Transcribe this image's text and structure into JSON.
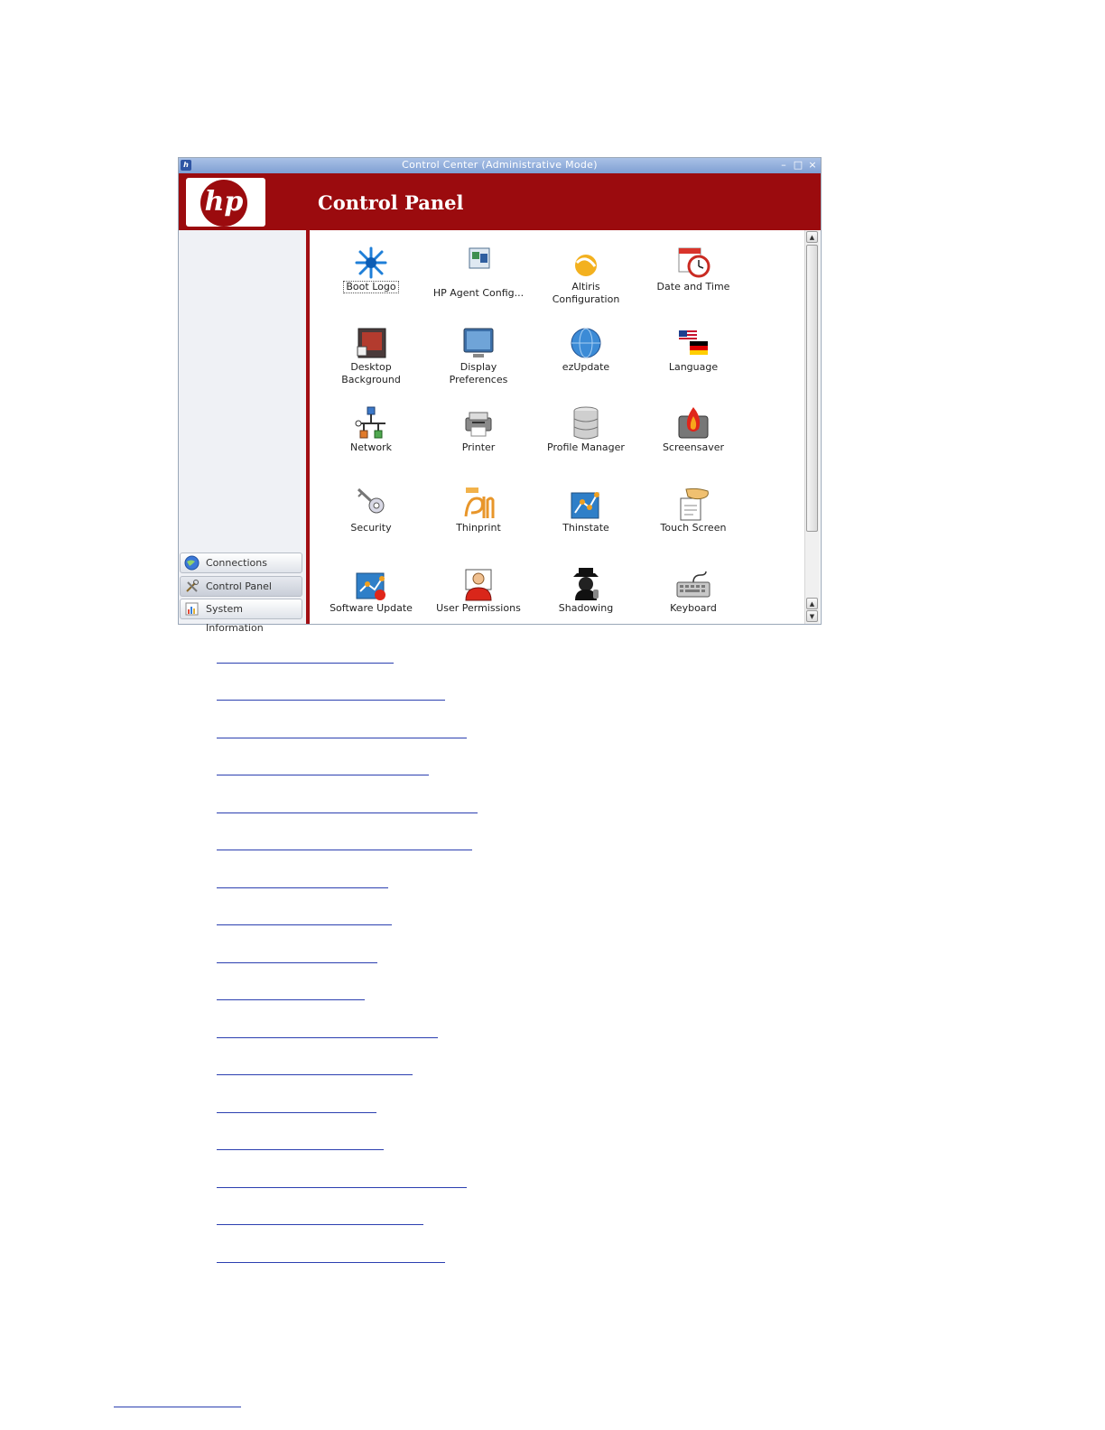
{
  "window": {
    "title": "Control Center (Administrative Mode)",
    "minimize_glyph": "–",
    "maximize_glyph": "□",
    "close_glyph": "×",
    "header_title": "Control Panel",
    "logo_text": "hp"
  },
  "sidebar": {
    "items": [
      {
        "label": "Connections",
        "icon": "globe-icon"
      },
      {
        "label": "Control Panel",
        "icon": "tools-icon"
      },
      {
        "label": "System Information",
        "icon": "chart-icon"
      }
    ]
  },
  "control_panel": {
    "items": [
      {
        "label": "Boot Logo",
        "icon": "splash-icon"
      },
      {
        "label": "HP Agent Config...",
        "icon": "agent-config-icon"
      },
      {
        "label": "Altiris\nConfiguration",
        "icon": "altiris-icon"
      },
      {
        "label": "Date and Time",
        "icon": "calendar-clock-icon"
      },
      {
        "label": "Desktop\nBackground",
        "icon": "desktop-background-icon"
      },
      {
        "label": "Display\nPreferences",
        "icon": "monitor-icon"
      },
      {
        "label": "ezUpdate",
        "icon": "globe-update-icon"
      },
      {
        "label": "Language",
        "icon": "flags-icon"
      },
      {
        "label": "Network",
        "icon": "network-icon"
      },
      {
        "label": "Printer",
        "icon": "printer-icon"
      },
      {
        "label": "Profile Manager",
        "icon": "database-icon"
      },
      {
        "label": "Screensaver",
        "icon": "screensaver-icon"
      },
      {
        "label": "Security",
        "icon": "key-icon"
      },
      {
        "label": "Thinprint",
        "icon": "thinprint-icon"
      },
      {
        "label": "Thinstate",
        "icon": "thinstate-icon"
      },
      {
        "label": "Touch Screen",
        "icon": "touch-screen-icon"
      },
      {
        "label": "Software Update",
        "icon": "software-update-icon"
      },
      {
        "label": "User Permissions",
        "icon": "user-permissions-icon"
      },
      {
        "label": "Shadowing",
        "icon": "shadowing-icon"
      },
      {
        "label": "Keyboard",
        "icon": "keyboard-icon"
      }
    ]
  },
  "scrollbar": {
    "up_glyph": "▲",
    "down_glyph": "▼"
  },
  "colors": {
    "brand_red": "#9b0b0e",
    "link_blue": "#2b3fb0",
    "titlebar_blue": "#7f9fd3"
  }
}
